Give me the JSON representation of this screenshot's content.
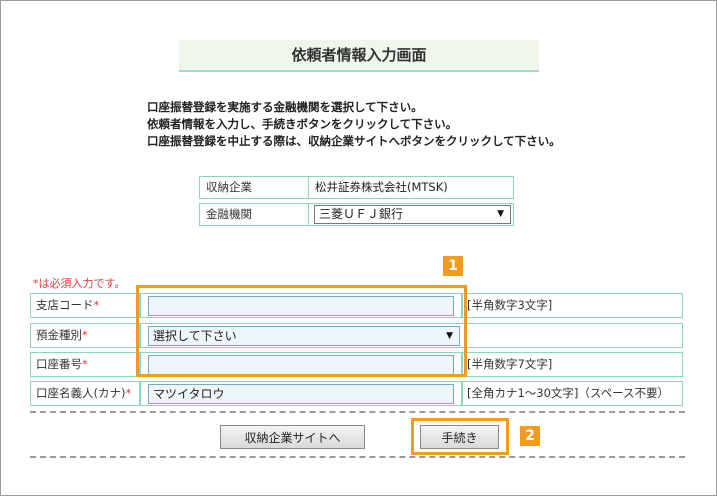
{
  "title": "依頼者情報入力画面",
  "instructions": [
    "口座振替登録を実施する金融機関を選択して下さい。",
    "依頼者情報を入力し、手続きボタンをクリックして下さい。",
    "口座振替登録を中止する際は、収納企業サイトへボタンをクリックして下さい。"
  ],
  "info": {
    "company_label": "収納企業",
    "company_value": "松井証券株式会社(MTSK)",
    "bank_label": "金融機関",
    "bank_selected": "三菱ＵＦＪ銀行"
  },
  "required_note": "*は必須入力です。",
  "form": {
    "branch_code": {
      "label": "支店コード",
      "req": "*",
      "value": "",
      "hint": "[半角数字3文字]"
    },
    "account_type": {
      "label": "預金種別",
      "req": "*",
      "selected": "選択して下さい"
    },
    "account_number": {
      "label": "口座番号",
      "req": "*",
      "value": "",
      "hint": "[半角数字7文字]"
    },
    "account_name": {
      "label": "口座名義人(カナ)",
      "req": "*",
      "value": "マツイタロウ",
      "hint": "[全角カナ1～30文字]（スペース不要）"
    }
  },
  "buttons": {
    "back_label": "収納企業サイトへ",
    "proceed_label": "手続き"
  },
  "annotations": {
    "badge1": "1",
    "badge2": "2",
    "highlight_color": "#f39a1f"
  }
}
